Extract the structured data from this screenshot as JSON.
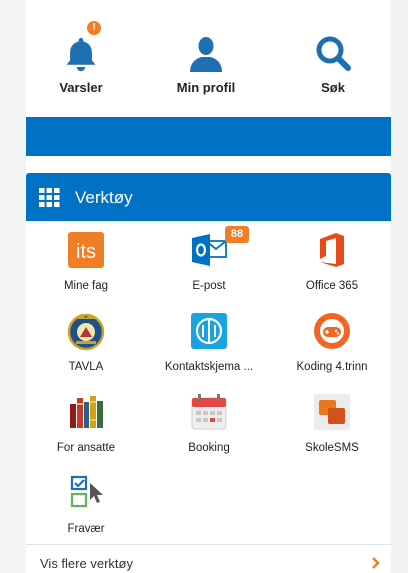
{
  "quick": {
    "items": [
      {
        "label": "Varsler",
        "icon": "bell-icon",
        "badge": "!"
      },
      {
        "label": "Min profil",
        "icon": "user-icon"
      },
      {
        "label": "Søk",
        "icon": "search-icon"
      }
    ]
  },
  "tools": {
    "title": "Verktøy",
    "icon": "grid-icon",
    "items": [
      {
        "label": "Mine fag",
        "icon": "its-icon"
      },
      {
        "label": "E-post",
        "icon": "outlook-icon",
        "badge": "88"
      },
      {
        "label": "Office 365",
        "icon": "office-icon"
      },
      {
        "label": "TAVLA",
        "icon": "oslo-crest-icon"
      },
      {
        "label": "Kontaktskjema ...",
        "icon": "contact-form-icon"
      },
      {
        "label": "Koding 4.trinn",
        "icon": "gamepad-icon"
      },
      {
        "label": "For ansatte",
        "icon": "books-icon"
      },
      {
        "label": "Booking",
        "icon": "calendar-icon"
      },
      {
        "label": "SkoleSMS",
        "icon": "sms-icon"
      },
      {
        "label": "Fravær",
        "icon": "checklist-cursor-icon"
      }
    ],
    "more_label": "Vis flere verktøy"
  },
  "colors": {
    "brand_blue": "#0072c6",
    "accent_orange": "#f07e26",
    "icon_blue": "#1e6fb2"
  }
}
